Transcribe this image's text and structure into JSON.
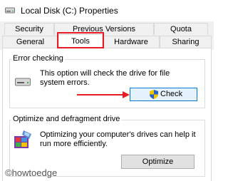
{
  "window": {
    "title": "Local Disk (C:) Properties"
  },
  "tabs": {
    "row_back": [
      "Security",
      "Previous Versions",
      "Quota"
    ],
    "row_front": [
      "General",
      "Tools",
      "Hardware",
      "Sharing"
    ],
    "active": "Tools"
  },
  "error_checking": {
    "group_title": "Error checking",
    "description": "This option will check the drive for file system errors.",
    "button_label": "Check"
  },
  "optimize": {
    "group_title": "Optimize and defragment drive",
    "description": "Optimizing your computer's drives can help it run more efficiently.",
    "button_label": "Optimize"
  },
  "watermark": "©howtoedge",
  "colors": {
    "highlight": "#e81c24",
    "accent": "#0078d7"
  }
}
